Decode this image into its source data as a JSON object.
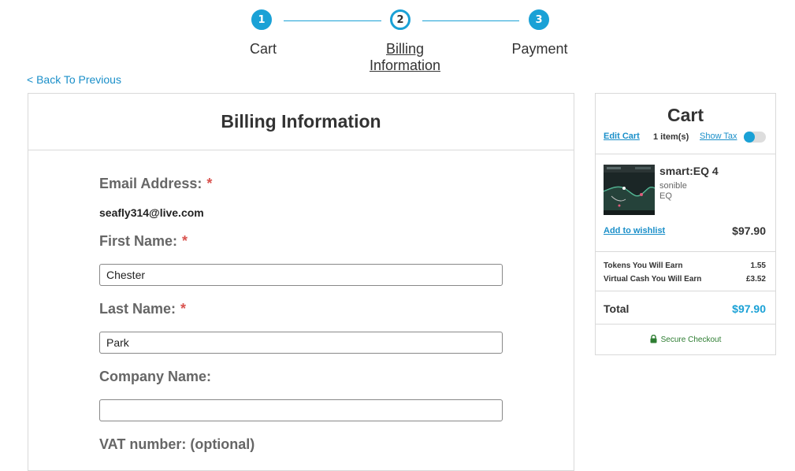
{
  "colors": {
    "accent": "#1aa1d6",
    "link": "#1a8fc9",
    "required": "#d9534f",
    "secure": "#2e7d32"
  },
  "steps": [
    {
      "number": "1",
      "label": "Cart",
      "state": "complete"
    },
    {
      "number": "2",
      "label": "Billing Information",
      "state": "current"
    },
    {
      "number": "3",
      "label": "Payment",
      "state": "complete"
    }
  ],
  "back_link": "< Back To Previous",
  "billing": {
    "title": "Billing Information",
    "email_label": "Email Address:",
    "email_value": "seafly314@live.com",
    "first_name_label": "First Name:",
    "first_name_value": "Chester",
    "last_name_label": "Last Name:",
    "last_name_value": "Park",
    "company_label": "Company Name:",
    "company_value": "",
    "vat_label": "VAT number: (optional)",
    "required_mark": "*"
  },
  "cart": {
    "title": "Cart",
    "edit_cart": "Edit Cart",
    "items_count": "1 item(s)",
    "show_tax": "Show Tax",
    "show_tax_on": false,
    "product": {
      "name": "smart:EQ 4",
      "brand": "sonible",
      "category": "EQ",
      "wishlist": "Add to wishlist",
      "price": "$97.90"
    },
    "tokens_label": "Tokens You Will Earn",
    "tokens_value": "1.55",
    "cash_label": "Virtual Cash You Will Earn",
    "cash_value": "£3.52",
    "total_label": "Total",
    "total_value": "$97.90",
    "secure_label": "Secure Checkout"
  }
}
